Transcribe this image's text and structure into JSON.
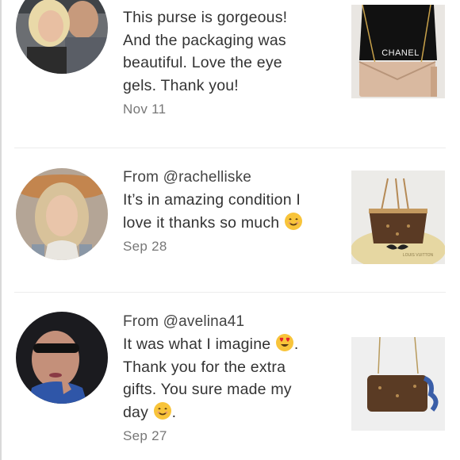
{
  "reviews": [
    {
      "from_prefix": "",
      "handle": "",
      "text_lines": [
        "This purse is gorgeous!",
        "And the packaging was",
        "beautiful. Love the eye",
        "gels. Thank you!"
      ],
      "date": "Nov 11",
      "product_icon": "chanel-bag-photo",
      "product_text": "CHANEL"
    },
    {
      "from_prefix": "From ",
      "handle": "@rachelliske",
      "text_lines": [
        "It’s in amazing condition I",
        "love it thanks so much"
      ],
      "date": "Sep 28",
      "product_icon": "lv-neverfull-bag-photo",
      "product_text": "LOUIS VUITTON"
    },
    {
      "from_prefix": "From ",
      "handle": "@avelina41",
      "text_lines": [
        "It was what I imagine",
        "Thank you for the extra",
        "gifts. You sure made my",
        "day"
      ],
      "date": "Sep 27",
      "product_icon": "lv-crossbody-bag-photo"
    }
  ],
  "emojis": {
    "smile": "smiling-face-emoji",
    "heart_eyes": "heart-eyes-emoji"
  },
  "colors": {
    "text": "#333333",
    "muted": "#777777",
    "divider": "#ececec",
    "emoji_yellow": "#f8c43a"
  }
}
